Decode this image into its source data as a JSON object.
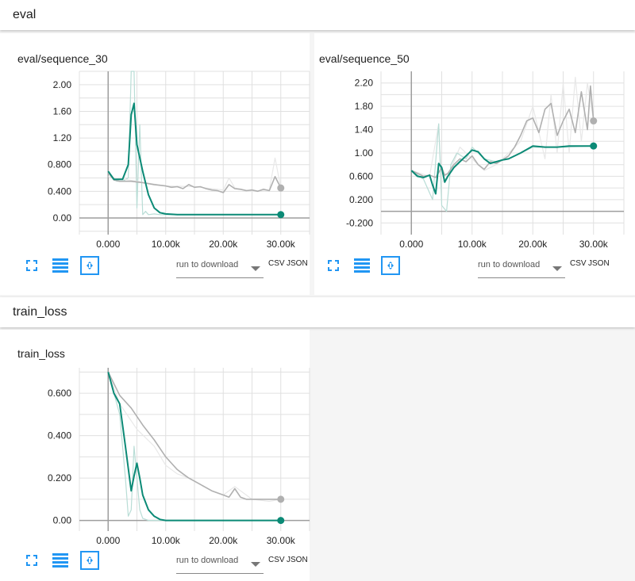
{
  "sections": [
    {
      "title": "eval"
    },
    {
      "title": "train_loss"
    }
  ],
  "charts": [
    {
      "title": "eval/sequence_30",
      "y_ticks": [
        "2.00",
        "1.60",
        "1.20",
        "0.800",
        "0.400",
        "0.00"
      ],
      "x_ticks": [
        "0.000",
        "10.00k",
        "20.00k",
        "30.00k"
      ]
    },
    {
      "title": "eval/sequence_50",
      "y_ticks": [
        "2.20",
        "1.80",
        "1.40",
        "1.00",
        "0.600",
        "0.200",
        "-0.200"
      ],
      "x_ticks": [
        "0.000",
        "10.00k",
        "20.00k",
        "30.00k"
      ]
    },
    {
      "title": "train_loss",
      "y_ticks": [
        "0.600",
        "0.400",
        "0.200",
        "0.00"
      ],
      "x_ticks": [
        "0.000",
        "10.00k",
        "20.00k",
        "30.00k"
      ]
    }
  ],
  "toolbar": {
    "download_placeholder": "run to download",
    "csv_label": "CSV",
    "json_label": "JSON"
  },
  "colors": {
    "smoothed": "#0b8a76",
    "raw": "#b9ddd6",
    "other": "#b0b0b0",
    "other_raw": "#e8e8e8",
    "grid": "#e0e0e0",
    "axis": "#9e9e9e"
  },
  "icons": [
    "fit-screen-icon",
    "list-icon",
    "fit-domain-icon"
  ],
  "chart_data": [
    {
      "type": "line",
      "title": "eval/sequence_30",
      "xlim": [
        -5000,
        35000
      ],
      "ylim": [
        -0.25,
        2.2
      ],
      "series": [
        {
          "role": "raw_teal",
          "x": [
            0,
            1500,
            2500,
            3500,
            4000,
            4500,
            5000,
            5500,
            6000,
            6500,
            7000,
            8000,
            9000,
            10000,
            12000,
            30000
          ],
          "y": [
            0.68,
            0.55,
            0.55,
            0.6,
            2.2,
            2.2,
            0.15,
            1.4,
            0.05,
            0.1,
            0.05,
            0.06,
            0.05,
            0.05,
            0.05,
            0.05
          ]
        },
        {
          "role": "raw_gray",
          "x": [
            0,
            5000,
            10000,
            15000,
            20000,
            21000,
            22000,
            25000,
            28000,
            29000,
            30000
          ],
          "y": [
            0.62,
            0.55,
            0.48,
            0.47,
            0.42,
            0.6,
            0.45,
            0.4,
            0.42,
            0.9,
            0.45
          ]
        },
        {
          "role": "smoothed_gray",
          "x": [
            0,
            1000,
            2000,
            4000,
            5000,
            6000,
            8000,
            10000,
            11000,
            12000,
            13000,
            14000,
            15000,
            16000,
            17000,
            18000,
            19000,
            20000,
            21000,
            22000,
            23000,
            24000,
            25000,
            26000,
            27000,
            28000,
            29000,
            30000
          ],
          "y": [
            0.68,
            0.57,
            0.55,
            0.55,
            0.54,
            0.53,
            0.5,
            0.48,
            0.46,
            0.47,
            0.44,
            0.5,
            0.46,
            0.47,
            0.44,
            0.42,
            0.41,
            0.38,
            0.5,
            0.44,
            0.43,
            0.41,
            0.42,
            0.4,
            0.43,
            0.41,
            0.62,
            0.45
          ]
        },
        {
          "role": "smoothed_teal",
          "x": [
            0,
            1000,
            2500,
            3500,
            4000,
            4500,
            5000,
            6000,
            7000,
            8000,
            9000,
            10000,
            12000,
            15000,
            20000,
            25000,
            30000
          ],
          "y": [
            0.7,
            0.58,
            0.58,
            0.8,
            1.55,
            1.72,
            1.1,
            0.7,
            0.35,
            0.15,
            0.08,
            0.06,
            0.05,
            0.05,
            0.05,
            0.05,
            0.05
          ]
        }
      ]
    },
    {
      "type": "line",
      "title": "eval/sequence_50",
      "xlim": [
        -5000,
        35000
      ],
      "ylim": [
        -0.4,
        2.4
      ],
      "series": [
        {
          "role": "raw_gray",
          "x": [
            0,
            3000,
            4500,
            5000,
            6000,
            8000,
            10000,
            12000,
            14000,
            16000,
            18000,
            20000,
            22000,
            23000,
            24000,
            25000,
            26000,
            27000,
            28000,
            29000,
            30000
          ],
          "y": [
            0.7,
            0.6,
            1.5,
            0.5,
            0.6,
            1.1,
            0.9,
            0.7,
            0.8,
            1.0,
            1.2,
            1.8,
            0.9,
            2.0,
            1.0,
            2.2,
            1.0,
            2.3,
            1.2,
            2.2,
            1.55
          ]
        },
        {
          "role": "raw_teal",
          "x": [
            0,
            2000,
            3500,
            4500,
            5000,
            5800,
            6500,
            7500,
            9000,
            10000,
            12000,
            14000,
            16000,
            18000,
            20000,
            25000,
            30000
          ],
          "y": [
            0.7,
            0.55,
            0.2,
            1.5,
            0.1,
            0.0,
            0.8,
            1.0,
            0.9,
            1.1,
            0.9,
            0.85,
            0.9,
            1.0,
            1.1,
            1.1,
            1.12
          ]
        },
        {
          "role": "smoothed_gray",
          "x": [
            0,
            2000,
            3000,
            4000,
            5000,
            5500,
            6000,
            7000,
            8000,
            9000,
            10000,
            11000,
            12000,
            13000,
            14000,
            15000,
            16000,
            17000,
            18000,
            19000,
            20000,
            21000,
            22000,
            23000,
            24000,
            25000,
            26000,
            27000,
            28000,
            29000,
            29500,
            30000
          ],
          "y": [
            0.7,
            0.6,
            0.62,
            0.58,
            0.75,
            0.62,
            0.65,
            0.8,
            0.9,
            0.85,
            0.95,
            0.8,
            0.72,
            0.85,
            0.82,
            0.88,
            0.95,
            1.1,
            1.3,
            1.55,
            1.6,
            1.35,
            1.75,
            1.85,
            1.3,
            1.55,
            1.75,
            1.35,
            2.05,
            1.4,
            2.15,
            1.55
          ]
        },
        {
          "role": "smoothed_teal",
          "x": [
            0,
            1000,
            2000,
            3000,
            3500,
            4000,
            4500,
            5000,
            5500,
            6000,
            7000,
            8000,
            9000,
            10000,
            11000,
            12000,
            13000,
            14000,
            15000,
            16000,
            18000,
            20000,
            22000,
            24000,
            26000,
            28000,
            30000
          ],
          "y": [
            0.7,
            0.6,
            0.58,
            0.62,
            0.45,
            0.3,
            0.82,
            0.75,
            0.5,
            0.6,
            0.75,
            0.85,
            0.95,
            1.05,
            1.02,
            0.9,
            0.82,
            0.85,
            0.88,
            0.9,
            1.0,
            1.12,
            1.1,
            1.1,
            1.12,
            1.12,
            1.12
          ]
        }
      ]
    },
    {
      "type": "line",
      "title": "train_loss",
      "xlim": [
        -5000,
        35000
      ],
      "ylim": [
        -0.05,
        0.72
      ],
      "series": [
        {
          "role": "raw_gray",
          "x": [
            0,
            2000,
            5000,
            8000,
            10000,
            12000,
            14000,
            18000,
            20000,
            22000,
            25000,
            28000,
            30000
          ],
          "y": [
            0.7,
            0.55,
            0.43,
            0.35,
            0.26,
            0.22,
            0.2,
            0.14,
            0.12,
            0.16,
            0.1,
            0.09,
            0.1
          ]
        },
        {
          "role": "raw_teal",
          "x": [
            0,
            2000,
            3000,
            3500,
            4000,
            4500,
            5000,
            5500,
            6000,
            7000,
            8000,
            10000,
            30000
          ],
          "y": [
            0.7,
            0.5,
            0.2,
            0.02,
            0.05,
            0.35,
            0.2,
            0.05,
            0.01,
            0.0,
            0.0,
            0.0,
            0.0
          ]
        },
        {
          "role": "smoothed_gray",
          "x": [
            0,
            2000,
            4000,
            6000,
            8000,
            10000,
            11000,
            12000,
            13000,
            14000,
            16000,
            18000,
            20000,
            21000,
            22000,
            23000,
            24000,
            26000,
            28000,
            30000
          ],
          "y": [
            0.7,
            0.59,
            0.53,
            0.45,
            0.38,
            0.3,
            0.27,
            0.24,
            0.22,
            0.2,
            0.17,
            0.14,
            0.12,
            0.11,
            0.15,
            0.11,
            0.1,
            0.1,
            0.1,
            0.1
          ]
        },
        {
          "role": "smoothed_teal",
          "x": [
            0,
            1000,
            2000,
            3000,
            4000,
            4500,
            5000,
            5500,
            6000,
            7000,
            8000,
            9000,
            10000,
            15000,
            20000,
            25000,
            30000
          ],
          "y": [
            0.7,
            0.6,
            0.55,
            0.35,
            0.14,
            0.21,
            0.27,
            0.2,
            0.12,
            0.05,
            0.02,
            0.005,
            0.0,
            0.0,
            0.0,
            0.0,
            0.0
          ]
        }
      ]
    }
  ]
}
